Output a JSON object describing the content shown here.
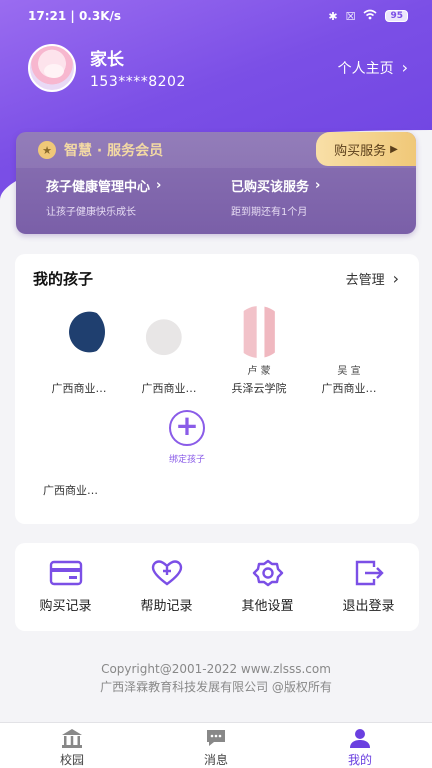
{
  "status_bar": {
    "time": "17:21",
    "speed": "0.3K/s",
    "battery": "95"
  },
  "profile": {
    "name": "家长",
    "phone": "153****8202",
    "home_link": "个人主页"
  },
  "vip": {
    "title": "智慧 · 服务会员",
    "buy_label": "购买服务",
    "items": [
      {
        "title": "孩子健康管理中心",
        "subtitle": "让孩子健康快乐成长"
      },
      {
        "title": "已购买该服务",
        "subtitle": "距到期还有1个月"
      }
    ]
  },
  "kids": {
    "title": "我的孩子",
    "manage_label": "去管理",
    "children": [
      {
        "name": "",
        "school": "广西商业…"
      },
      {
        "name": "",
        "school": "广西商业…"
      },
      {
        "name": "卢    蒙",
        "school": "兵泽云学院"
      },
      {
        "name": "吴    宣",
        "school": "广西商业…"
      }
    ],
    "fifth_school": "广西商业…",
    "add_label": "绑定孩子"
  },
  "tools": [
    {
      "label": "购买记录",
      "icon": "card-icon"
    },
    {
      "label": "帮助记录",
      "icon": "heart-plus-icon"
    },
    {
      "label": "其他设置",
      "icon": "gear-icon"
    },
    {
      "label": "退出登录",
      "icon": "logout-icon"
    }
  ],
  "footer": {
    "copyright": "Copyright@2001-2022 www.zlsss.com",
    "company": "广西泽霖教育科技发展有限公司 @版权所有"
  },
  "tabs": [
    {
      "label": "校园",
      "icon": "school-icon"
    },
    {
      "label": "消息",
      "icon": "message-icon"
    },
    {
      "label": "我的",
      "icon": "user-icon",
      "active": true
    }
  ],
  "colors": {
    "accent": "#6a3fe0",
    "gold": "#f0c878"
  }
}
